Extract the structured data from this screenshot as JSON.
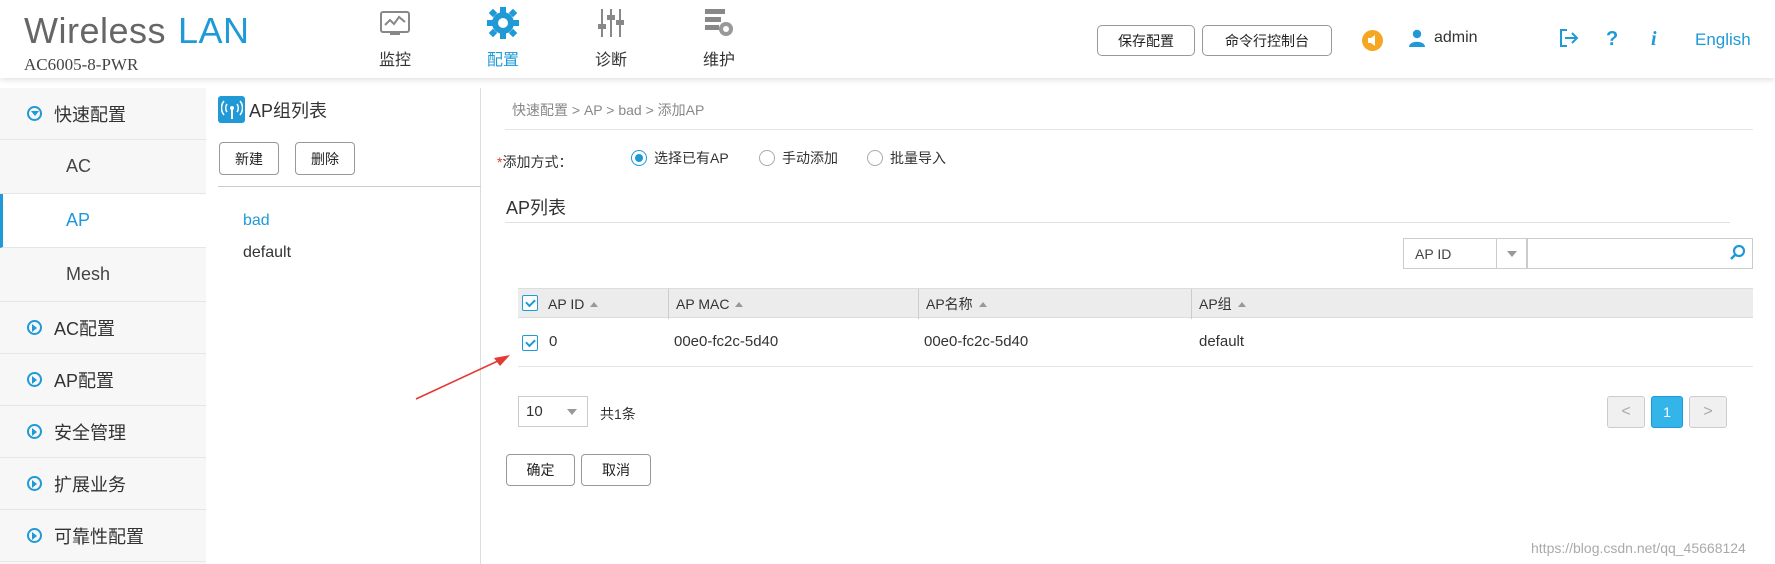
{
  "header": {
    "brand_word": "Wireless",
    "brand_lan": "LAN",
    "model": "AC6005-8-PWR",
    "nav": [
      {
        "label": "监控",
        "icon": "monitor-icon"
      },
      {
        "label": "配置",
        "icon": "gear-icon"
      },
      {
        "label": "诊断",
        "icon": "sliders-icon"
      },
      {
        "label": "维护",
        "icon": "maintenance-icon"
      }
    ],
    "save_config": "保存配置",
    "cli_console": "命令行控制台",
    "username": "admin",
    "language": "English",
    "help_glyph": "?",
    "info_glyph": "i",
    "accent": "#1f9ad6"
  },
  "sidebar": {
    "items": [
      {
        "label": "快速配置",
        "expanded": true
      },
      {
        "label": "AC"
      },
      {
        "label": "AP",
        "active": true
      },
      {
        "label": "Mesh"
      },
      {
        "label": "AC配置"
      },
      {
        "label": "AP配置"
      },
      {
        "label": "安全管理"
      },
      {
        "label": "扩展业务"
      },
      {
        "label": "可靠性配置"
      }
    ]
  },
  "group_panel": {
    "title": "AP组列表",
    "new_label": "新建",
    "delete_label": "删除",
    "groups": [
      "bad",
      "default"
    ]
  },
  "main": {
    "breadcrumb": "快速配置 > AP > bad > 添加AP",
    "add_method_label": "添加方式：",
    "required_mark": "*",
    "methods": [
      "选择已有AP",
      "手动添加",
      "批量导入"
    ],
    "selected_method": "选择已有AP",
    "section_title": "AP列表",
    "filter_field": "AP ID",
    "search_value": "",
    "columns": [
      "AP ID",
      "AP MAC",
      "AP名称",
      "AP组"
    ],
    "rows": [
      {
        "ap_id": "0",
        "ap_mac": "00e0-fc2c-5d40",
        "ap_name": "00e0-fc2c-5d40",
        "ap_group": "default",
        "checked": true
      }
    ],
    "page_size": "10",
    "total_text": "共1条",
    "current_page": "1",
    "prev_glyph": "<",
    "next_glyph": ">",
    "confirm_label": "确定",
    "cancel_label": "取消"
  },
  "watermark": "https://blog.csdn.net/qq_45668124"
}
